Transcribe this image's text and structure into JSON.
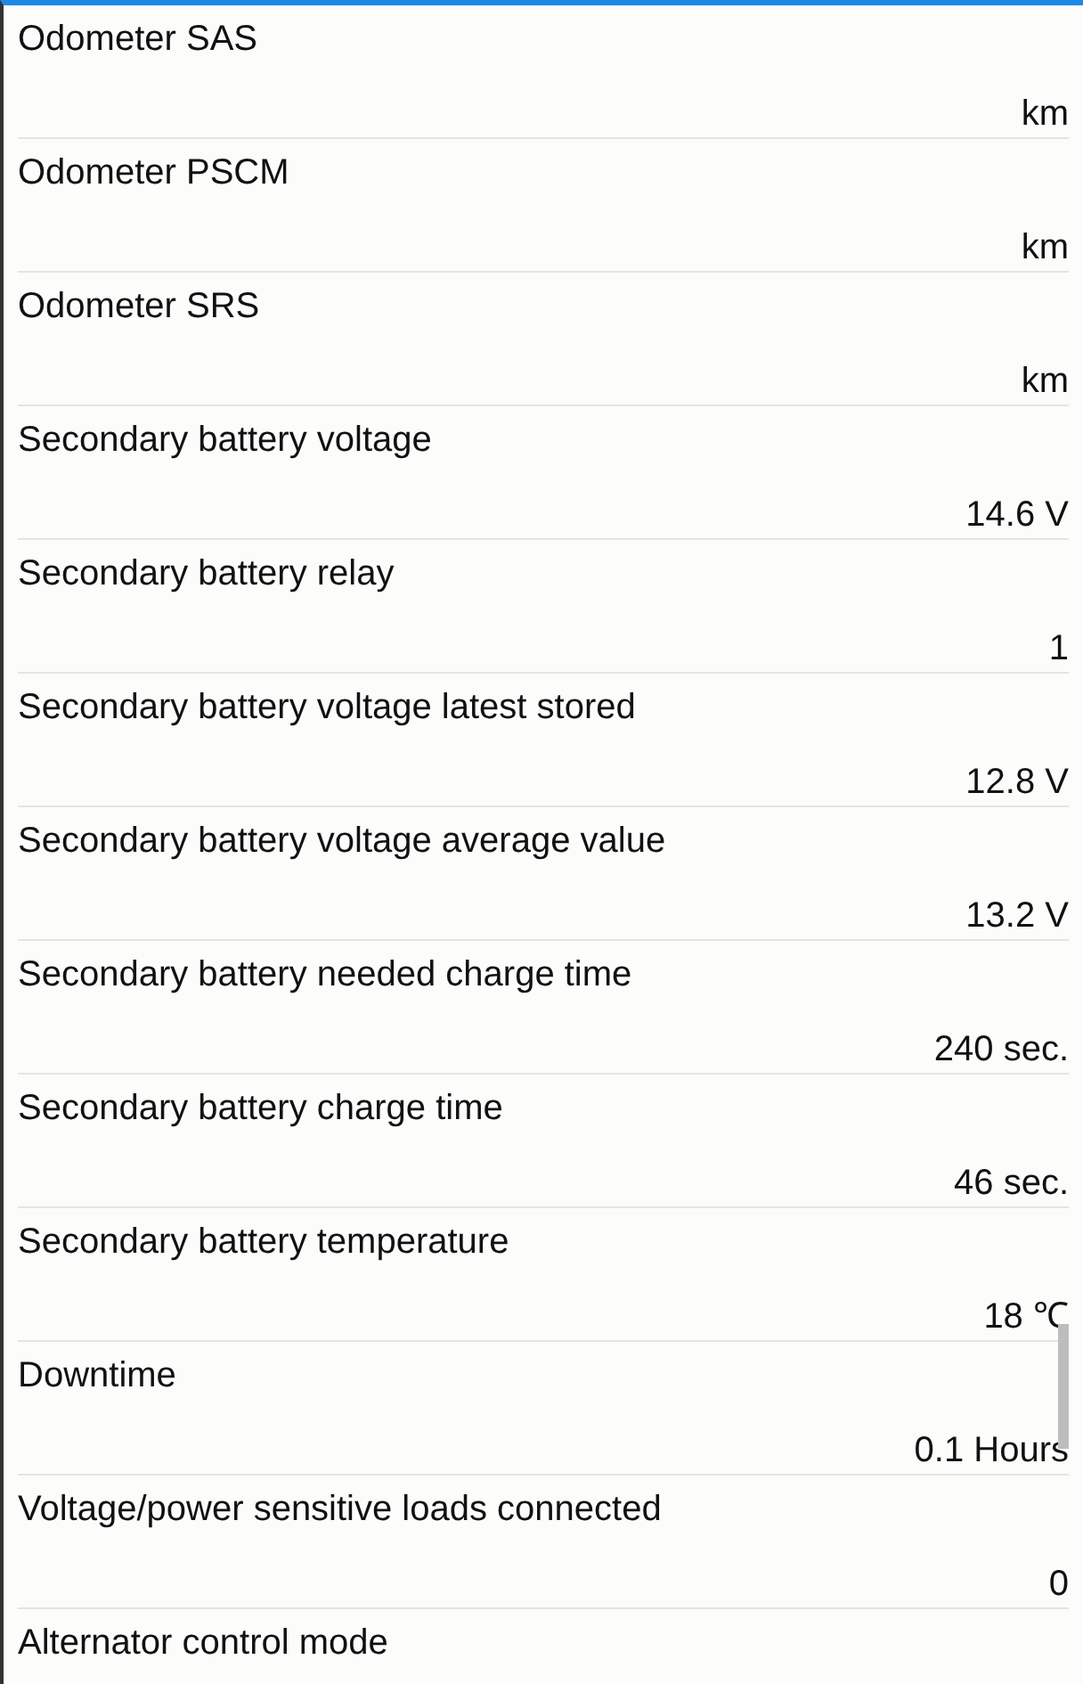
{
  "rows": [
    {
      "label": "Odometer SAS",
      "value": "km"
    },
    {
      "label": "Odometer PSCM",
      "value": "km"
    },
    {
      "label": "Odometer SRS",
      "value": "km"
    },
    {
      "label": "Secondary battery voltage",
      "value": "14.6 V"
    },
    {
      "label": "Secondary battery relay",
      "value": "1"
    },
    {
      "label": "Secondary battery voltage latest stored",
      "value": "12.8 V"
    },
    {
      "label": "Secondary battery voltage average value",
      "value": "13.2 V"
    },
    {
      "label": "Secondary battery needed charge time",
      "value": "240 sec."
    },
    {
      "label": "Secondary battery charge time",
      "value": "46 sec."
    },
    {
      "label": "Secondary battery temperature",
      "value": "18 ℃"
    },
    {
      "label": "Downtime",
      "value": "0.1 Hours"
    },
    {
      "label": "Voltage/power sensitive loads connected",
      "value": "0"
    },
    {
      "label": "Alternator control mode"
    }
  ]
}
